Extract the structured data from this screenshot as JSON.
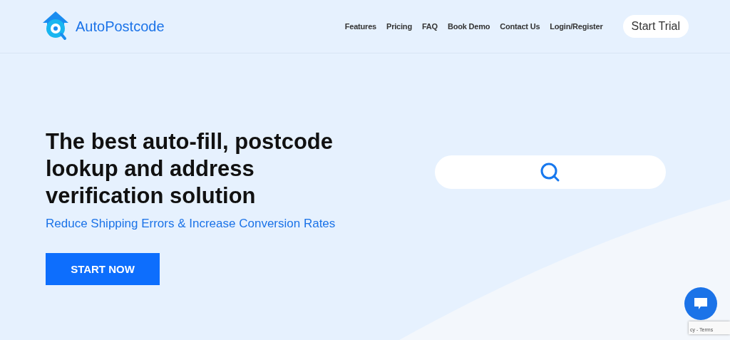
{
  "header": {
    "brand": "AutoPostcode",
    "nav": [
      {
        "label": "Features"
      },
      {
        "label": "Pricing"
      },
      {
        "label": "FAQ"
      },
      {
        "label": "Book Demo"
      },
      {
        "label": "Contact Us"
      },
      {
        "label": "Login/Register"
      }
    ],
    "cta": "Start Trial"
  },
  "hero": {
    "heading": "The best auto-fill, postcode lookup and address verification solution",
    "subtitle": "Reduce Shipping Errors & Increase Conversion Rates",
    "button": "START NOW"
  },
  "recaptcha": {
    "text": "cy - Terms"
  }
}
